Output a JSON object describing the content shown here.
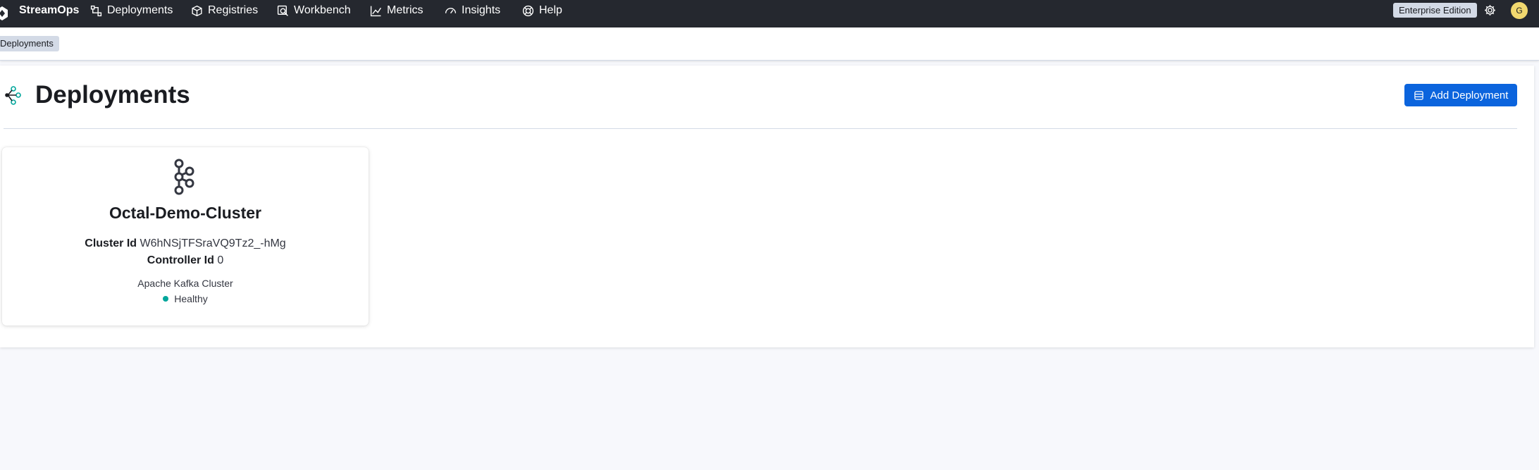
{
  "nav": {
    "brand": "StreamOps",
    "items": [
      {
        "label": "Deployments",
        "icon": "deployments-icon"
      },
      {
        "label": "Registries",
        "icon": "registries-icon"
      },
      {
        "label": "Workbench",
        "icon": "workbench-icon"
      },
      {
        "label": "Metrics",
        "icon": "metrics-icon"
      },
      {
        "label": "Insights",
        "icon": "insights-icon"
      },
      {
        "label": "Help",
        "icon": "help-icon"
      }
    ],
    "edition": "Enterprise Edition",
    "avatar": "G"
  },
  "breadcrumb": {
    "current": "Deployments"
  },
  "page": {
    "title": "Deployments",
    "add_button": "Add Deployment"
  },
  "cluster": {
    "name": "Octal-Demo-Cluster",
    "cluster_id_label": "Cluster Id",
    "cluster_id": "W6hNSjTFSraVQ9Tz2_-hMg",
    "controller_id_label": "Controller Id",
    "controller_id": "0",
    "type": "Apache Kafka Cluster",
    "status": "Healthy",
    "status_color": "#00a69b"
  },
  "colors": {
    "topbar": "#25282f",
    "primary": "#0b64dd",
    "avatar": "#f1d86f"
  }
}
